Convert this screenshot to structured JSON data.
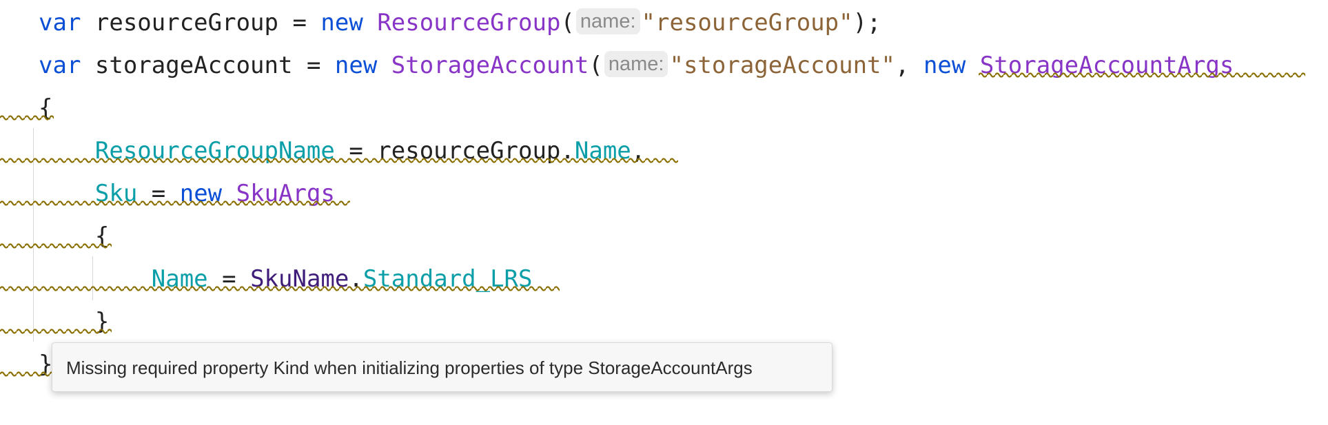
{
  "editor": {
    "lines": [
      {
        "tokens": [
          {
            "text": "var",
            "kind": "kw"
          },
          {
            "text": " resourceGroup = ",
            "kind": "plain"
          },
          {
            "text": "new",
            "kind": "kw"
          },
          {
            "text": " ",
            "kind": "plain"
          },
          {
            "text": "ResourceGroup",
            "kind": "cls"
          },
          {
            "text": "(",
            "kind": "plain"
          },
          {
            "text": "name:",
            "kind": "hint"
          },
          {
            "text": "\"resourceGroup\"",
            "kind": "string"
          },
          {
            "text": ");",
            "kind": "plain"
          }
        ]
      },
      {
        "tokens": [
          {
            "text": "var",
            "kind": "kw"
          },
          {
            "text": " storageAccount = ",
            "kind": "plain"
          },
          {
            "text": "new",
            "kind": "kw"
          },
          {
            "text": " ",
            "kind": "plain"
          },
          {
            "text": "StorageAccount",
            "kind": "cls"
          },
          {
            "text": "(",
            "kind": "plain"
          },
          {
            "text": "name:",
            "kind": "hint"
          },
          {
            "text": "\"storageAccount\"",
            "kind": "string"
          },
          {
            "text": ", ",
            "kind": "plain"
          },
          {
            "text": "new",
            "kind": "kw"
          },
          {
            "text": " ",
            "kind": "plain"
          },
          {
            "text": "StorageAccountArgs",
            "kind": "cls"
          }
        ]
      },
      {
        "tokens": [
          {
            "text": "{",
            "kind": "plain"
          }
        ]
      },
      {
        "tokens": [
          {
            "text": "    ",
            "kind": "plain"
          },
          {
            "text": "ResourceGroupName",
            "kind": "prop"
          },
          {
            "text": " = resourceGroup.",
            "kind": "plain"
          },
          {
            "text": "Name",
            "kind": "prop"
          },
          {
            "text": ",",
            "kind": "plain"
          }
        ]
      },
      {
        "tokens": [
          {
            "text": "    ",
            "kind": "plain"
          },
          {
            "text": "Sku",
            "kind": "prop"
          },
          {
            "text": " = ",
            "kind": "plain"
          },
          {
            "text": "new",
            "kind": "kw"
          },
          {
            "text": " ",
            "kind": "plain"
          },
          {
            "text": "SkuArgs",
            "kind": "cls"
          }
        ]
      },
      {
        "tokens": [
          {
            "text": "    {",
            "kind": "plain"
          }
        ]
      },
      {
        "tokens": [
          {
            "text": "        ",
            "kind": "plain"
          },
          {
            "text": "Name",
            "kind": "prop"
          },
          {
            "text": " = ",
            "kind": "plain"
          },
          {
            "text": "SkuName",
            "kind": "enum"
          },
          {
            "text": ".",
            "kind": "plain"
          },
          {
            "text": "Standard_LRS",
            "kind": "prop"
          }
        ]
      },
      {
        "tokens": [
          {
            "text": "    }",
            "kind": "plain"
          }
        ]
      },
      {
        "tokens": [
          {
            "text": "}",
            "kind": "plain"
          }
        ]
      }
    ]
  },
  "tooltip": {
    "message": "Missing required property Kind when initializing properties of type StorageAccountArgs"
  },
  "colors": {
    "keyword": "#0b4fd6",
    "class": "#8734c7",
    "string": "#8c6437",
    "property": "#0a9ea8",
    "enum": "#3f1c7a",
    "warning_squiggle": "#8a7000"
  }
}
